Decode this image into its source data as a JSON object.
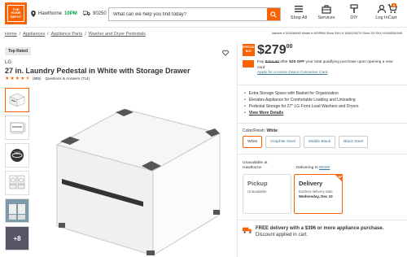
{
  "header": {
    "logo_text": "THE HOME DEPOT",
    "store_name": "Hawthorne",
    "store_hours": "10PM",
    "zip": "90250",
    "search_placeholder": "What can we help you find today?",
    "nav": [
      {
        "label": "Shop All",
        "icon": "menu-icon"
      },
      {
        "label": "Services",
        "icon": "toolbox-icon"
      },
      {
        "label": "DIY",
        "icon": "paintbrush-icon"
      },
      {
        "label": "Log In",
        "icon": "user-icon"
      }
    ],
    "cart_label": "Cart",
    "cart_count": "0"
  },
  "breadcrumb": [
    "Home",
    "Appliances",
    "Appliance Parts",
    "Washer and Dryer Pedestals"
  ],
  "ids": "Internet # 324336460   Model # WDP6W   Store SKU # 1006229270   Store SO SKU #1006551948",
  "product": {
    "badge": "Top Rated",
    "brand": "LG",
    "title": "27 in. Laundry Pedestal in White with Storage Drawer",
    "rating_stars": 4.5,
    "review_count": "(885)",
    "qa": "Questions & Answers (714)",
    "thumb_more": "+8"
  },
  "pricing": {
    "special_label": "SPECIAL BUY",
    "price_dollars": "$279",
    "price_cents": "00",
    "card_old": "$254.00",
    "card_after": "after",
    "card_off": "$25 OFF",
    "card_text": "your total qualifying purchase upon opening a new card",
    "card_link": "Apply for a Home Depot Consumer Card"
  },
  "features": [
    "Extra Storage Space with Basket for Organization",
    "Elevates Appliance for Comfortable Loading and Unloading",
    "Pedestal Storage for 27\" LG Front Load Washers and Dryers"
  ],
  "features_link": "View More Details",
  "color": {
    "label": "Color/Finish:",
    "selected": "White",
    "options": [
      "White",
      "Graphite Steel",
      "Middle Black",
      "Black Steel"
    ]
  },
  "fulfillment": {
    "unavailable_label": "Unavailable at",
    "unavailable_store": "Hawthorne",
    "delivering_label": "Delivering to",
    "delivering_zip": "90250",
    "pickup_title": "Pickup",
    "pickup_sub": "Unavailable",
    "delivery_title": "Delivery",
    "delivery_sub": "Earliest delivery date",
    "delivery_date": "Wednesday, Dec 10"
  },
  "free_delivery": {
    "bold": "FREE delivery with a $396 or more appliance purchase.",
    "rest": "Discount applied in cart."
  },
  "colors": {
    "brand_orange": "#f96302",
    "link_blue": "#3e7697",
    "open_green": "#00a34a"
  }
}
